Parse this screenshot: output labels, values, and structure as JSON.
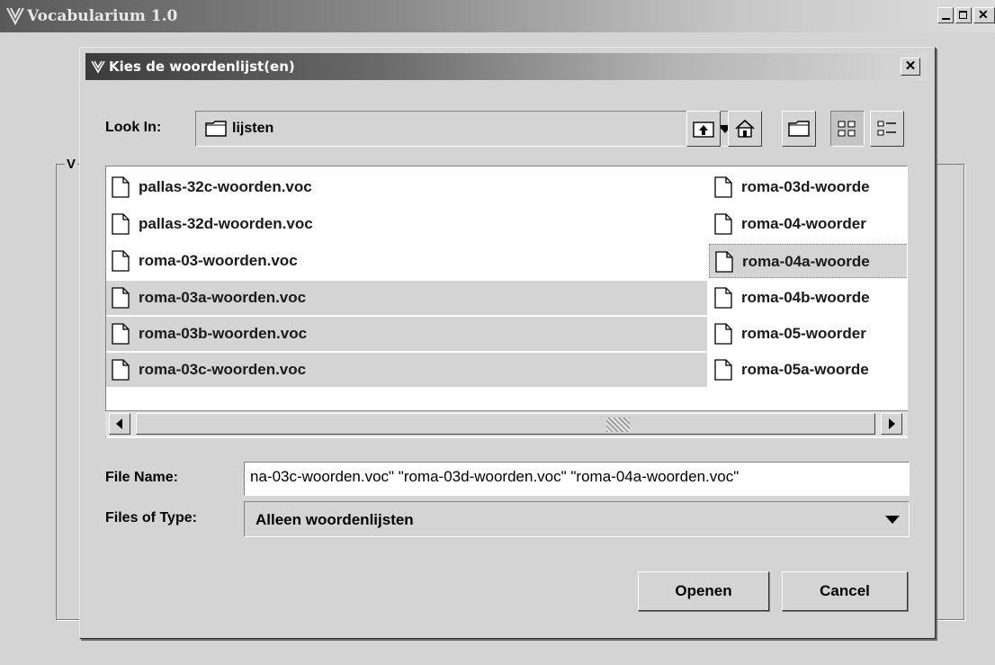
{
  "main_window": {
    "title": "Vocabularium 1.0",
    "group_label": "V",
    "controls": [
      "minimize-icon",
      "maximize-icon",
      "close-icon"
    ]
  },
  "dialog": {
    "title": "Kies de woordenlijst(en)",
    "close_glyph": "✕",
    "look_in_label": "Look In:",
    "look_in_value": "lijsten",
    "toolbar": [
      "up-folder-icon",
      "home-icon",
      "new-folder-icon",
      "list-view-icon",
      "details-view-icon"
    ],
    "files_col1": [
      "pallas-32c-woorden.voc",
      "pallas-32d-woorden.voc",
      "roma-03-woorden.voc",
      "roma-03a-woorden.voc",
      "roma-03b-woorden.voc",
      "roma-03c-woorden.voc"
    ],
    "files_col2": [
      "roma-03d-woorde",
      "roma-04-woorder",
      "roma-04a-woorde",
      "roma-04b-woorde",
      "roma-05-woorder",
      "roma-05a-woorde"
    ],
    "file_name_label": "File Name:",
    "file_name_value": "na-03c-woorden.voc\" \"roma-03d-woorden.voc\" \"roma-04a-woorden.voc\"",
    "files_of_type_label": "Files of Type:",
    "files_of_type_value": "Alleen woordenlijsten",
    "open_label": "Openen",
    "cancel_label": "Cancel"
  }
}
